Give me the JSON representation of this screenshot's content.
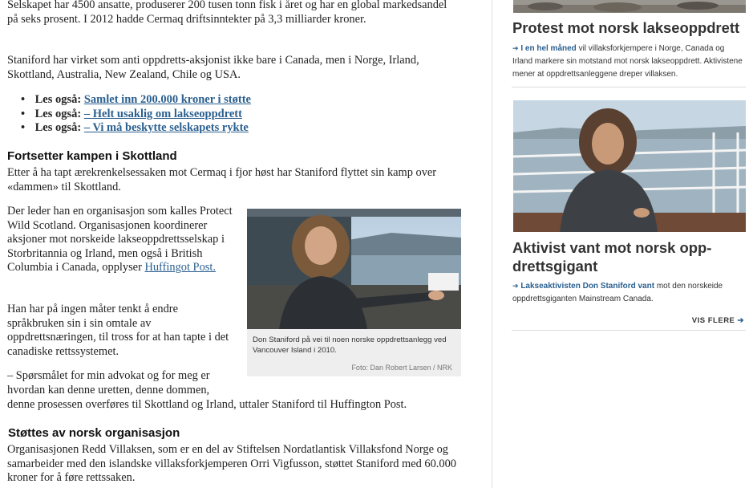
{
  "article": {
    "p1": "Selskapet har 4500 ansatte, produserer 200 tusen tonn fisk i året og har en global markedsandel på seks prosent. I 2012 hadde Cermaq driftsinntekter på 3,3 milliarder kroner.",
    "p2": "Staniford har virket som anti oppdretts-aksjonist ikke bare i Canada, men i Norge, Irland, Skottland, Australia, New Zealand, Chile og USA.",
    "related": [
      {
        "prefix": "Les også:",
        "link": "Samlet inn 200.000 kroner i støtte"
      },
      {
        "prefix": "Les også:",
        "link": "– Helt usaklig om lakseoppdrett"
      },
      {
        "prefix": "Les også:",
        "link": "– Vi må beskytte selskapets rykte"
      }
    ],
    "heading1": "Fortsetter kampen i Skottland",
    "p3": "Etter å ha tapt ærekrenkelsessaken mot Cermaq i fjor høst har Staniford flyttet sin kamp over «dammen» til Skottland.",
    "p4_pre": "Der leder han en organisasjon som kalles Protect Wild Scotland. Organisasjonen koordinerer aksjoner mot norskeide lakseoppdrettsselskap i Storbritannia og Irland, men også i British Columbia i Canada, opplyser ",
    "p4_link": "Huffingot Post.",
    "p5": "Han har på ingen måter tenkt å endre språkbruken sin i sin omtale av oppdrettsnæringen, til tross for at han tapte i det canadiske rettssystemet.",
    "p6_a": "– Spørsmålet for min advokat og for meg er hvordan kan denne uretten, denne dommen,",
    "p6_b": "denne prosessen overføres til Skottland og Irland, uttaler Staniford til Huffington Post.",
    "heading2": "Støttes av norsk organisasjon",
    "p7": "Organisasjonen Redd Villaksen, som er en del av Stiftelsen Nordatlantisk Villaksfond Norge og samarbeider med den islandske villaksforkjemperen Orri Vigfusson, støttet Staniford med 60.000 kroner for å føre rettssaken.",
    "figure": {
      "caption": "Don Staniford på vei til noen norske oppdrettsanlegg ved Vancouver Island i 2010.",
      "credit": "Foto: Dan Robert Larsen / NRK"
    }
  },
  "sidebar": {
    "item1": {
      "title": "Protest mot norsk lakseoppdrett",
      "lead": "I en hel måned",
      "text": " vil villaksforkjempere i Norge, Canada og Irland markere sin motstand mot norsk lakseoppdrett. Akti­vistene mener at oppdrettsanleggene dreper villaksen."
    },
    "item2": {
      "title": "Aktivist vant mot norsk opp­drettsgigant",
      "lead": "Lakseaktivisten Don Staniford vant",
      "text": " mot den norsk­eide oppdrettsgiganten Mainstream Canada."
    },
    "more_label": "VIS FLERE",
    "arrow_glyph": "➔"
  },
  "colors": {
    "link": "#2a5f8f",
    "caption_bg": "#eeeeee"
  }
}
